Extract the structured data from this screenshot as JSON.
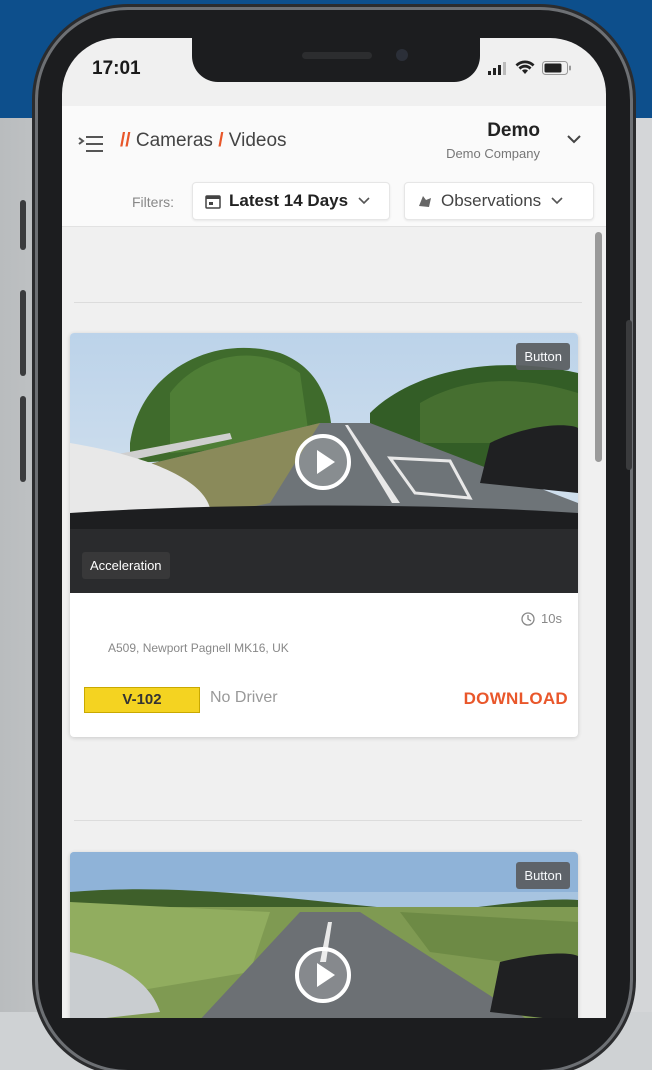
{
  "status_bar": {
    "time": "17:01"
  },
  "header": {
    "breadcrumb": {
      "separator": "//",
      "section": "Cameras",
      "divider": "/",
      "page": "Videos"
    },
    "user": {
      "name": "Demo",
      "company": "Demo Company"
    },
    "filters": {
      "label": "Filters:",
      "date_range": "Latest 14 Days",
      "type": "Observations"
    }
  },
  "videos": [
    {
      "trigger_badge": "Button",
      "event_label": "Acceleration",
      "duration": "10s",
      "location": "A509, Newport Pagnell MK16, UK",
      "vehicle": "V-102",
      "driver": "No Driver",
      "action": "DOWNLOAD"
    },
    {
      "trigger_badge": "Button"
    }
  ],
  "colors": {
    "accent": "#e9572b",
    "vehicle_tag": "#f4d321",
    "brand_bg": "#0d4f8c"
  }
}
